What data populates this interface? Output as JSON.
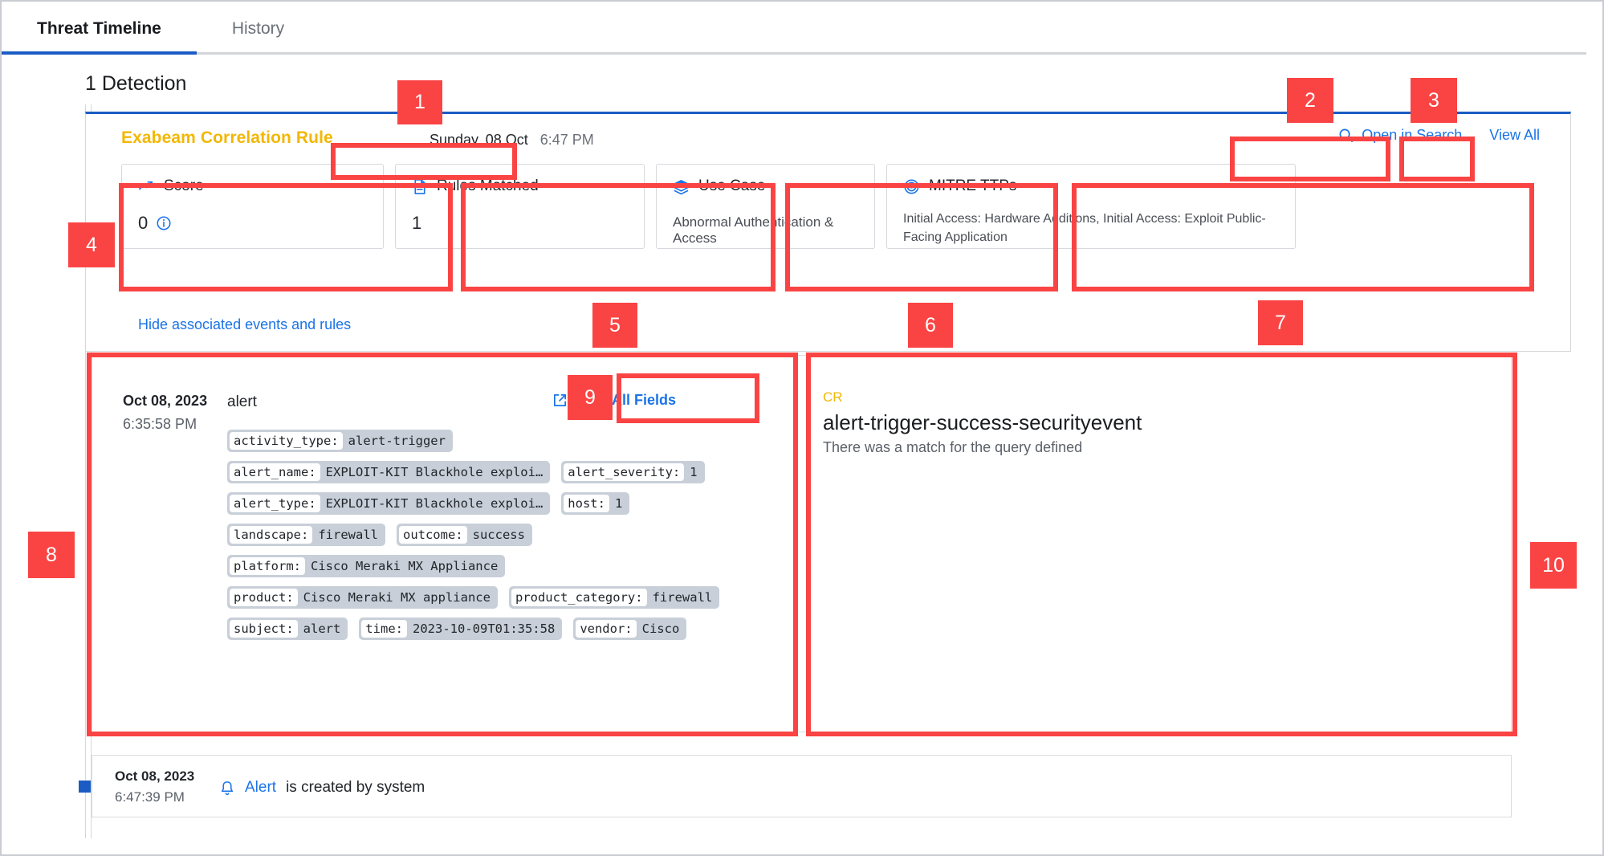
{
  "tabs": [
    {
      "label": "Threat Timeline",
      "active": true
    },
    {
      "label": "History",
      "active": false
    }
  ],
  "detection_count_label": "1 Detection",
  "detection": {
    "rule_title": "Exabeam Correlation Rule",
    "timestamp_date": "Sunday, 08 Oct",
    "timestamp_time": "6:47 PM",
    "actions": {
      "open_in_search": "Open in Search",
      "view_all": "View All"
    },
    "cards": [
      {
        "icon": "trending-up-icon",
        "title": "Score",
        "value": "0",
        "has_info": true
      },
      {
        "icon": "document-icon",
        "title": "Rules Matched",
        "value": "1",
        "has_info": false
      },
      {
        "icon": "layers-icon",
        "title": "Use Case",
        "value": "Abnormal Authentication & Access",
        "has_info": false
      },
      {
        "icon": "target-icon",
        "title": "MITRE TTPs",
        "value": "Initial Access: Hardware Additions, Initial Access: Exploit Public-Facing Application",
        "has_info": false
      }
    ],
    "toggle_link": "Hide associated events and rules"
  },
  "event": {
    "date": "Oct 08, 2023",
    "time": "6:35:58 PM",
    "name": "alert",
    "view_all_fields": "View All Fields",
    "fields": [
      {
        "key": "activity_type:",
        "value": "alert-trigger"
      },
      {
        "key": "alert_name:",
        "value": "EXPLOIT-KIT Blackhole exploi…"
      },
      {
        "key": "alert_severity:",
        "value": "1"
      },
      {
        "key": "alert_type:",
        "value": "EXPLOIT-KIT Blackhole exploi…"
      },
      {
        "key": "host:",
        "value": "1"
      },
      {
        "key": "landscape:",
        "value": "firewall"
      },
      {
        "key": "outcome:",
        "value": "success"
      },
      {
        "key": "platform:",
        "value": "Cisco Meraki MX Appliance"
      },
      {
        "key": "product:",
        "value": "Cisco Meraki MX appliance"
      },
      {
        "key": "product_category:",
        "value": "firewall"
      },
      {
        "key": "subject:",
        "value": "alert"
      },
      {
        "key": "time:",
        "value": "2023-10-09T01:35:58"
      },
      {
        "key": "vendor:",
        "value": "Cisco"
      }
    ]
  },
  "rule_panel": {
    "badge": "CR",
    "name": "alert-trigger-success-securityevent",
    "description": "There was a match for the query defined"
  },
  "alert_row": {
    "date": "Oct 08, 2023",
    "time": "6:47:39 PM",
    "link_text": "Alert",
    "message": "is created by system"
  },
  "annotations": [
    {
      "num": "1"
    },
    {
      "num": "2"
    },
    {
      "num": "3"
    },
    {
      "num": "4"
    },
    {
      "num": "5"
    },
    {
      "num": "6"
    },
    {
      "num": "7"
    },
    {
      "num": "8"
    },
    {
      "num": "9"
    },
    {
      "num": "10"
    }
  ],
  "colors": {
    "accent_blue": "#1a73e8",
    "tab_active": "#1b5cc4",
    "rule_gold": "#f2b705",
    "annotation_red": "#fa4444",
    "chip_bg": "#c8cfd8"
  }
}
